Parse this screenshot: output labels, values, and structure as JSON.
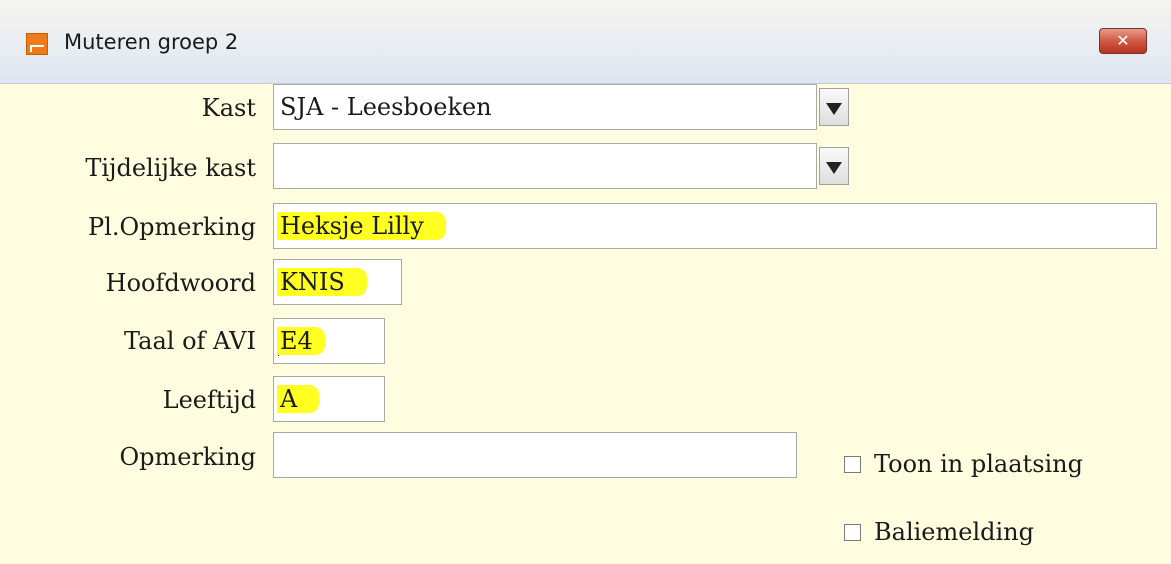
{
  "window": {
    "title": "Muteren groep 2",
    "close_label": "✕"
  },
  "form": {
    "kast": {
      "label": "Kast",
      "value": "SJA - Leesboeken"
    },
    "tijdelijke_kast": {
      "label": "Tijdelijke kast",
      "value": ""
    },
    "pl_opmerking": {
      "label": "Pl.Opmerking",
      "value": "Heksje Lilly"
    },
    "hoofdwoord": {
      "label": "Hoofdwoord",
      "value": "KNIS"
    },
    "taal_of_avi": {
      "label": "Taal of AVI",
      "value": "E4"
    },
    "leeftijd": {
      "label": "Leeftijd",
      "value": "A"
    },
    "opmerking": {
      "label": "Opmerking",
      "value": ""
    }
  },
  "checkboxes": {
    "toon_in_plaatsing": {
      "label": "Toon in plaatsing",
      "checked": false
    },
    "baliemelding": {
      "label": "Baliemelding",
      "checked": false
    }
  },
  "colors": {
    "background": "#fffddf",
    "highlight": "#ffff22",
    "close_button": "#c6452f"
  }
}
